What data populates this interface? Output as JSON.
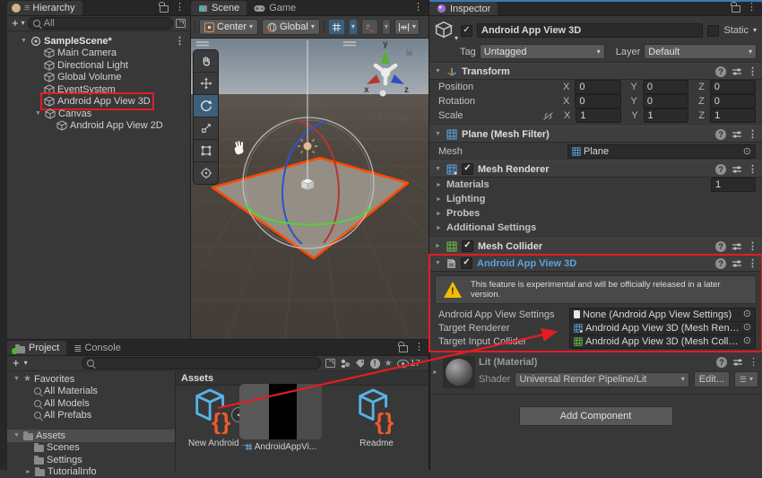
{
  "hierarchy": {
    "tab_label": "Hierarchy",
    "search_value": "All",
    "scene_label": "SampleScene*",
    "items": [
      {
        "label": "Main Camera"
      },
      {
        "label": "Directional Light"
      },
      {
        "label": "Global Volume"
      },
      {
        "label": "EventSystem"
      },
      {
        "label": "Android App View 3D"
      },
      {
        "label": "Canvas"
      },
      {
        "label": "Android App View 2D"
      }
    ]
  },
  "scene_view": {
    "tab_scene": "Scene",
    "tab_game": "Game",
    "pivot_label": "Center",
    "orientation_label": "Global",
    "persp_label": "Persp",
    "axis": {
      "x": "x",
      "y": "y",
      "z": "z"
    }
  },
  "inspector": {
    "tab_label": "Inspector",
    "object_name": "Android App View 3D",
    "static_label": "Static",
    "tag_label": "Tag",
    "tag_value": "Untagged",
    "layer_label": "Layer",
    "layer_value": "Default",
    "transform": {
      "title": "Transform",
      "x_label": "X",
      "y_label": "Y",
      "z_label": "Z",
      "position_label": "Position",
      "position": {
        "x": "0",
        "y": "0",
        "z": "0"
      },
      "rotation_label": "Rotation",
      "rotation": {
        "x": "0",
        "y": "0",
        "z": "0"
      },
      "scale_label": "Scale",
      "scale": {
        "x": "1",
        "y": "1",
        "z": "1"
      }
    },
    "mesh_filter": {
      "title": "Plane (Mesh Filter)",
      "mesh_label": "Mesh",
      "mesh_value": "Plane"
    },
    "mesh_renderer": {
      "title": "Mesh Renderer",
      "materials_label": "Materials",
      "materials_count": "1",
      "lighting_label": "Lighting",
      "probes_label": "Probes",
      "additional_label": "Additional Settings"
    },
    "mesh_collider": {
      "title": "Mesh Collider"
    },
    "app_view": {
      "title": "Android App View 3D",
      "warning": "This feature is experimental and will be officially released in a later version.",
      "settings_label": "Android App View Settings",
      "settings_value": "None (Android App View Settings)",
      "renderer_label": "Target Renderer",
      "renderer_value": "Android App View 3D (Mesh Renderer)",
      "collider_label": "Target Input Collider",
      "collider_value": "Android App View 3D (Mesh Collider)"
    },
    "material": {
      "title": "Lit (Material)",
      "shader_label": "Shader",
      "shader_value": "Universal Render Pipeline/Lit",
      "edit_label": "Edit..."
    },
    "add_component_label": "Add Component"
  },
  "project": {
    "tab_project": "Project",
    "tab_console": "Console",
    "favorites_label": "Favorites",
    "favorites": [
      {
        "label": "All Materials"
      },
      {
        "label": "All Models"
      },
      {
        "label": "All Prefabs"
      }
    ],
    "assets_label": "Assets",
    "folders": [
      {
        "label": "Scenes"
      },
      {
        "label": "Settings"
      },
      {
        "label": "TutorialInfo"
      }
    ],
    "hidden_count": "17"
  },
  "assets_panel": {
    "header": "Assets",
    "items": [
      {
        "label": "New Android ..."
      },
      {
        "label": "AndroidAppVi..."
      },
      {
        "label": "Readme"
      }
    ]
  },
  "colors": {
    "accent": "#3a79bb",
    "annotation": "#e51c23",
    "warning_yellow": "#f5bc00",
    "component_title_blue": "#59a3e2",
    "scriptable_cube_blue": "#58b2e6",
    "brace_orange": "#ef5b2e"
  }
}
